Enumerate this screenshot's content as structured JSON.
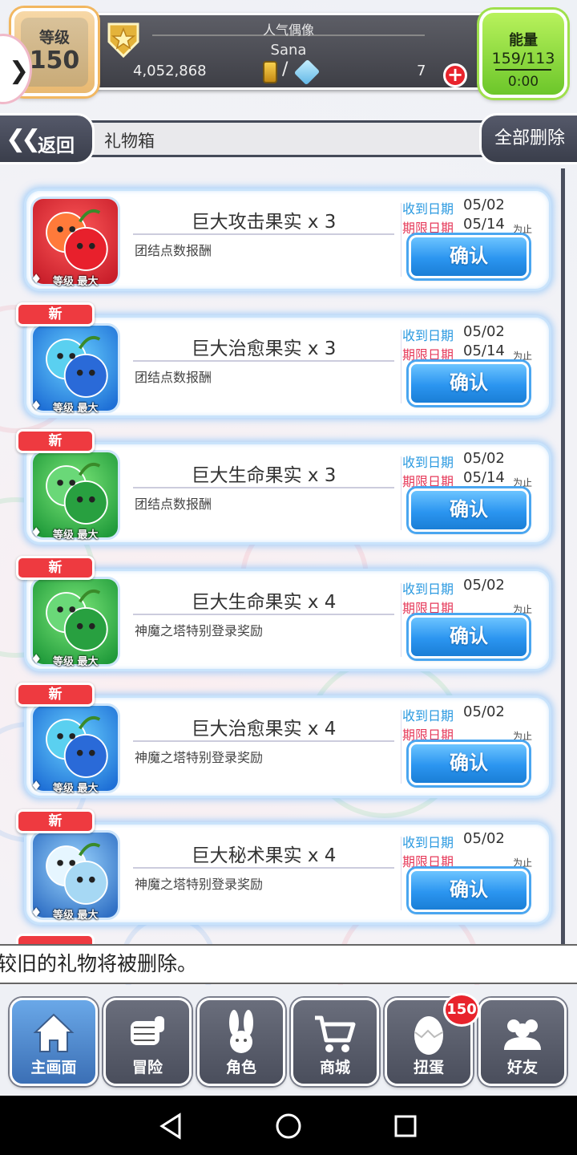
{
  "status": {
    "level_label": "等级",
    "level_value": "150",
    "title": "人气偶像",
    "player_name": "Sana",
    "gold": "4,052,868",
    "gold_separator": "/",
    "gem_count": "7",
    "energy_label": "能量",
    "energy_value": "159/113",
    "energy_timer": "0:00"
  },
  "header": {
    "back_label": "返回",
    "title": "礼物箱",
    "delete_all_label": "全部删除"
  },
  "gift_labels": {
    "received_label": "收到日期",
    "expiry_label": "期限日期",
    "until_label": "为止",
    "confirm_label": "确认",
    "new_label": "新",
    "max_level_label": "等级 最大"
  },
  "gifts": [
    {
      "name": "巨大攻击果实 x 3",
      "source": "团结点数报酬",
      "received": "05/02",
      "expiry": "05/14",
      "is_new": false,
      "theme": "red"
    },
    {
      "name": "巨大治愈果实 x 3",
      "source": "团结点数报酬",
      "received": "05/02",
      "expiry": "05/14",
      "is_new": true,
      "theme": "blue"
    },
    {
      "name": "巨大生命果实 x 3",
      "source": "团结点数报酬",
      "received": "05/02",
      "expiry": "05/14",
      "is_new": true,
      "theme": "green"
    },
    {
      "name": "巨大生命果实 x 4",
      "source": "神魔之塔特别登录奖励",
      "received": "05/02",
      "expiry": "",
      "is_new": true,
      "theme": "green"
    },
    {
      "name": "巨大治愈果实 x 4",
      "source": "神魔之塔特别登录奖励",
      "received": "05/02",
      "expiry": "",
      "is_new": true,
      "theme": "blue"
    },
    {
      "name": "巨大秘术果实 x 4",
      "source": "神魔之塔特别登录奖励",
      "received": "05/02",
      "expiry": "",
      "is_new": true,
      "theme": "light"
    }
  ],
  "notice": "较旧的礼物将被删除。",
  "nav": [
    {
      "label": "主画面",
      "icon": "home-icon",
      "active": true
    },
    {
      "label": "冒险",
      "icon": "fist-icon",
      "active": false
    },
    {
      "label": "角色",
      "icon": "rabbit-icon",
      "active": false
    },
    {
      "label": "商城",
      "icon": "cart-icon",
      "active": false
    },
    {
      "label": "扭蛋",
      "icon": "egg-icon",
      "active": false
    },
    {
      "label": "好友",
      "icon": "friends-icon",
      "active": false
    }
  ],
  "gacha_badge": "150",
  "colors": {
    "received": "#2c9ae0",
    "expiry": "#e63b5b",
    "confirm": "#2b95f0",
    "new_tag": "#ee3a40",
    "energy": "#8fd83c"
  }
}
